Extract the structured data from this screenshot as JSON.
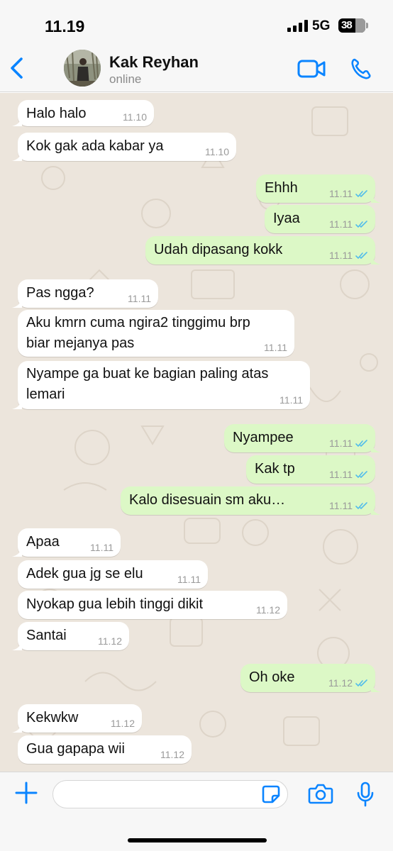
{
  "status_bar": {
    "time": "11.19",
    "network": "5G",
    "battery": "38"
  },
  "header": {
    "contact_name": "Kak Reyhan",
    "contact_status": "online"
  },
  "icons": {
    "back": "chevron-left-icon",
    "video": "video-call-icon",
    "phone": "phone-call-icon",
    "plus": "plus-icon",
    "sticker": "sticker-icon",
    "camera": "camera-icon",
    "mic": "microphone-icon"
  },
  "colors": {
    "accent": "#0a84ff",
    "outgoing_bubble": "#dcf8c6",
    "incoming_bubble": "#ffffff",
    "read_ticks": "#53bdeb",
    "chat_background": "#ece5dc"
  },
  "messages": [
    {
      "dir": "in",
      "text": "Halo halo",
      "time": "11.10"
    },
    {
      "dir": "in",
      "text": "Kok gak ada kabar ya",
      "time": "11.10"
    },
    {
      "dir": "out",
      "text": "Ehhh",
      "time": "11.11",
      "read": true
    },
    {
      "dir": "out",
      "text": "Iyaa",
      "time": "11.11",
      "read": true
    },
    {
      "dir": "out",
      "text": "Udah dipasang kokk",
      "time": "11.11",
      "read": true
    },
    {
      "dir": "in",
      "text": "Pas ngga?",
      "time": "11.11"
    },
    {
      "dir": "in",
      "text": "Aku kmrn cuma ngira2 tinggimu brp\nbiar mejanya pas",
      "time": "11.11"
    },
    {
      "dir": "in",
      "text": "Nyampe ga buat ke bagian paling atas\nlemari",
      "time": "11.11"
    },
    {
      "dir": "out",
      "text": "Nyampee",
      "time": "11.11",
      "read": true
    },
    {
      "dir": "out",
      "text": "Kak tp",
      "time": "11.11",
      "read": true
    },
    {
      "dir": "out",
      "text": "Kalo disesuain sm aku…",
      "time": "11.11",
      "read": true
    },
    {
      "dir": "in",
      "text": "Apaa",
      "time": "11.11"
    },
    {
      "dir": "in",
      "text": "Adek gua jg se elu",
      "time": "11.11"
    },
    {
      "dir": "in",
      "text": "Nyokap gua lebih tinggi dikit",
      "time": "11.12"
    },
    {
      "dir": "in",
      "text": "Santai",
      "time": "11.12"
    },
    {
      "dir": "out",
      "text": "Oh oke",
      "time": "11.12",
      "read": true
    },
    {
      "dir": "in",
      "text": "Kekwkw",
      "time": "11.12"
    },
    {
      "dir": "in",
      "text": "Gua gapapa wii",
      "time": "11.12"
    }
  ]
}
